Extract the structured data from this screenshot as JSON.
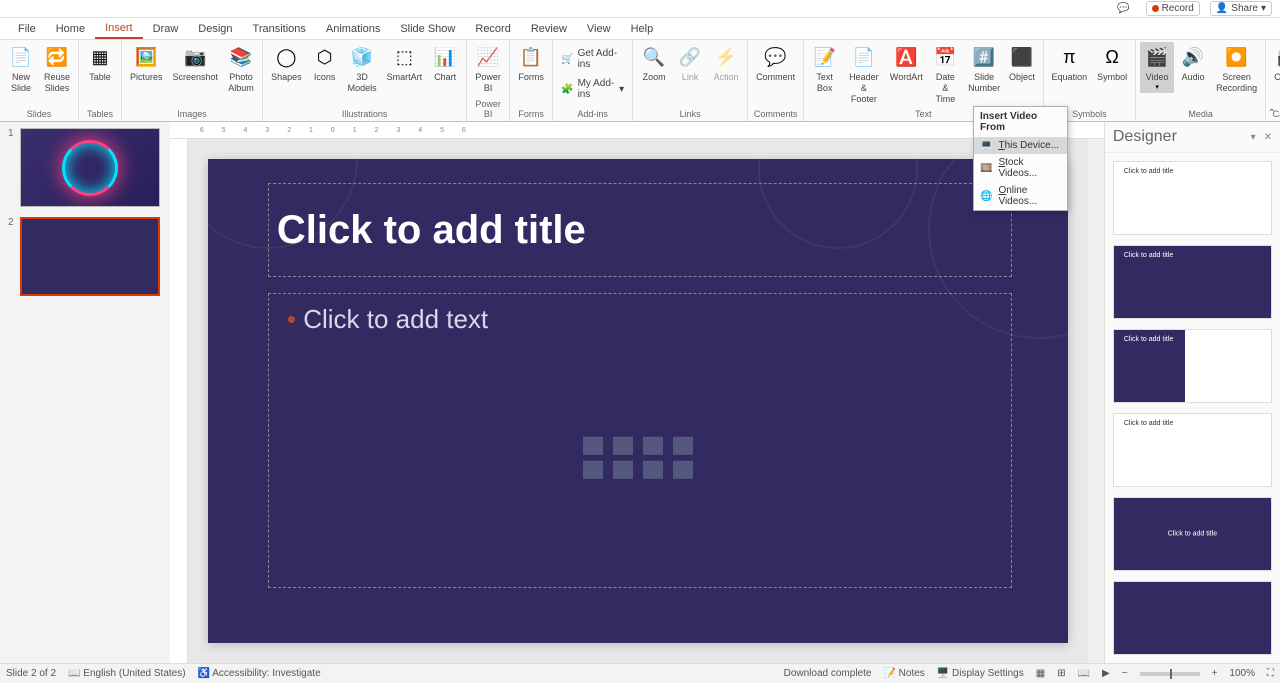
{
  "topbar": {
    "record": "Record",
    "share": "Share"
  },
  "tabs": [
    "File",
    "Home",
    "Insert",
    "Draw",
    "Design",
    "Transitions",
    "Animations",
    "Slide Show",
    "Record",
    "Review",
    "View",
    "Help"
  ],
  "active_tab": "Insert",
  "ribbon": {
    "groups": {
      "slides": {
        "label": "Slides",
        "new_slide": "New\nSlide",
        "reuse_slides": "Reuse\nSlides"
      },
      "tables": {
        "label": "Tables",
        "table": "Table"
      },
      "images": {
        "label": "Images",
        "pictures": "Pictures",
        "screenshot": "Screenshot",
        "photo_album": "Photo\nAlbum"
      },
      "illustrations": {
        "label": "Illustrations",
        "shapes": "Shapes",
        "icons": "Icons",
        "models": "3D\nModels",
        "smartart": "SmartArt",
        "chart": "Chart"
      },
      "powerbi": {
        "label": "Power BI",
        "powerbi": "Power\nBI"
      },
      "forms": {
        "label": "Forms",
        "forms": "Forms"
      },
      "addins": {
        "label": "Add-ins",
        "get": "Get Add-ins",
        "my": "My Add-ins"
      },
      "links": {
        "label": "Links",
        "zoom": "Zoom",
        "link": "Link",
        "action": "Action"
      },
      "comments": {
        "label": "Comments",
        "comment": "Comment"
      },
      "text": {
        "label": "Text",
        "textbox": "Text\nBox",
        "header": "Header\n& Footer",
        "wordart": "WordArt",
        "datetime": "Date &\nTime",
        "slidenum": "Slide\nNumber",
        "object": "Object"
      },
      "symbols": {
        "label": "Symbols",
        "equation": "Equation",
        "symbol": "Symbol"
      },
      "media": {
        "label": "Media",
        "video": "Video",
        "audio": "Audio",
        "screen": "Screen\nRecording"
      },
      "camera": {
        "label": "Camera",
        "cameo": "Cameo"
      }
    }
  },
  "video_menu": {
    "header": "Insert Video From",
    "this_device": "his Device...",
    "this_device_u": "T",
    "stock": "tock Videos...",
    "stock_u": "S",
    "online": "nline Videos...",
    "online_u": "O"
  },
  "slide": {
    "title_placeholder": "Click to add title",
    "content_placeholder": "Click to add text"
  },
  "thumbs": {
    "count": 2
  },
  "designer": {
    "title": "Designer",
    "card_title": "Click to add title"
  },
  "statusbar": {
    "slide_info": "Slide 2 of 2",
    "language": "English (United States)",
    "accessibility": "Accessibility: Investigate",
    "download": "Download complete",
    "notes": "Notes",
    "display": "Display Settings",
    "zoom": "100%"
  }
}
